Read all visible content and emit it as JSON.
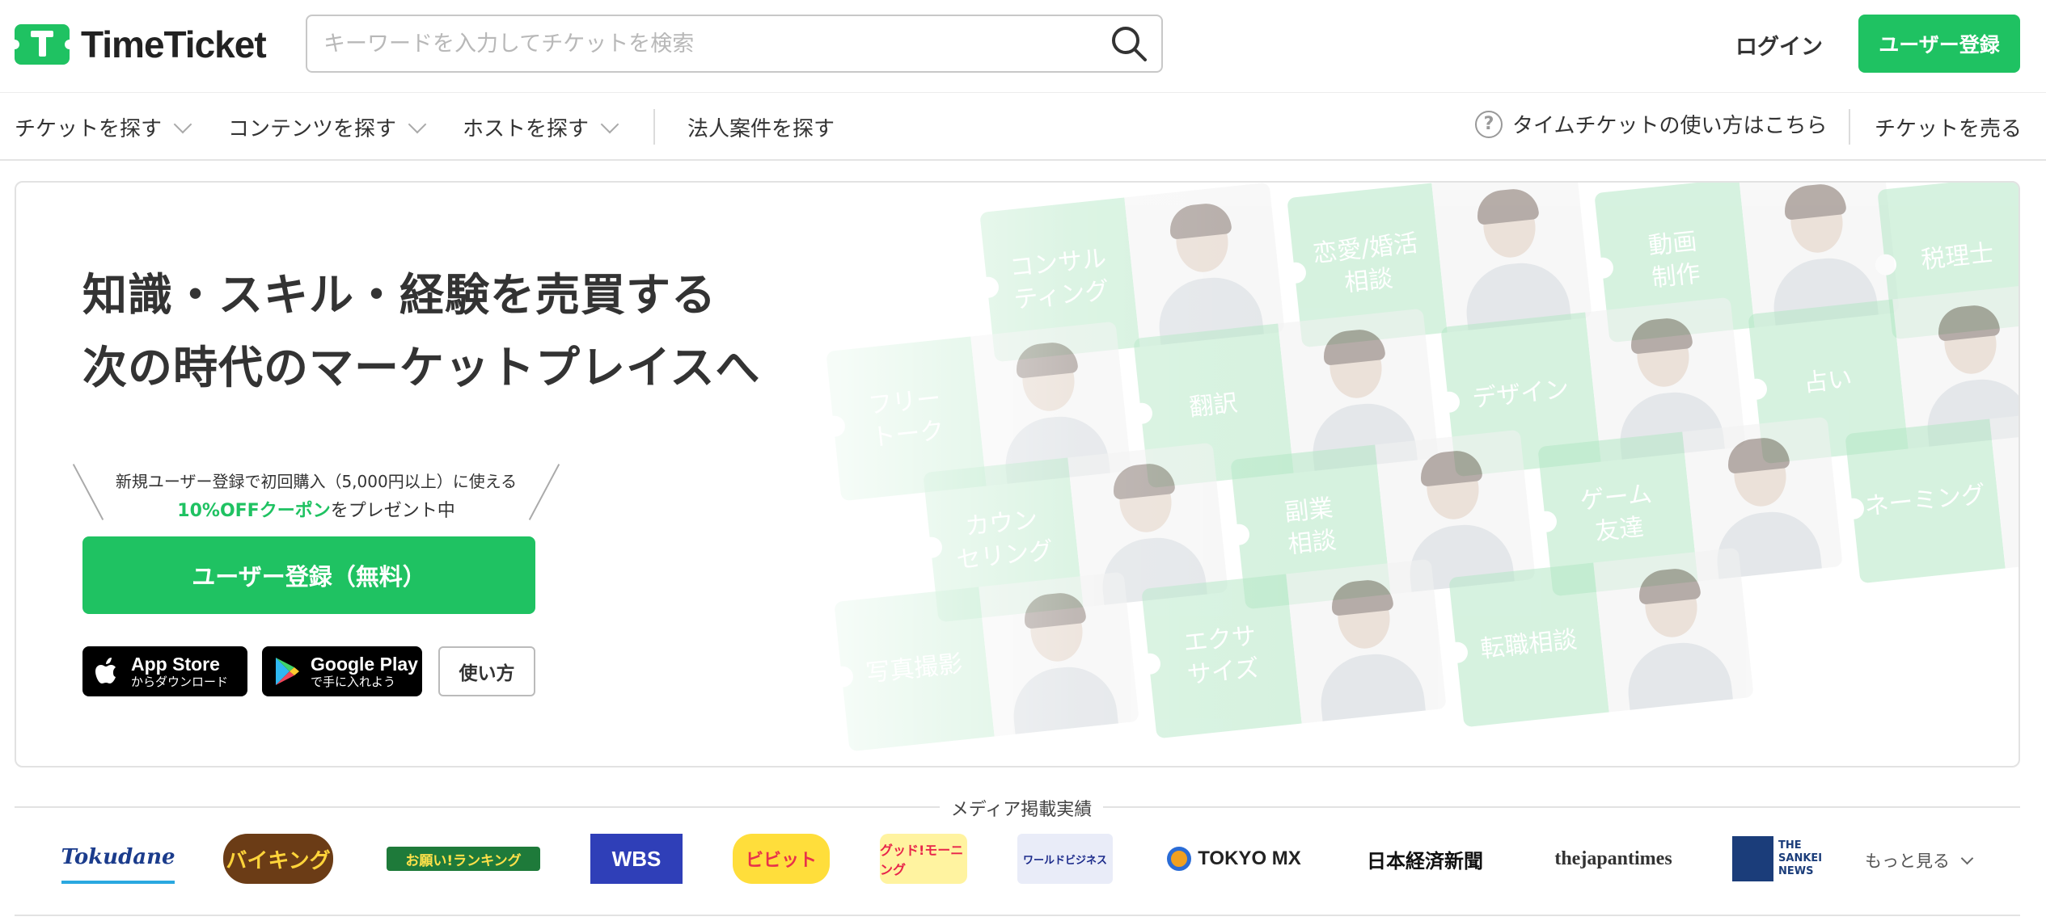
{
  "header": {
    "logo_text": "TimeTicket",
    "search_placeholder": "キーワードを入力してチケットを検索",
    "login_label": "ログイン",
    "register_label": "ユーザー登録"
  },
  "nav": {
    "items": [
      {
        "label": "チケットを探す"
      },
      {
        "label": "コンテンツを探す"
      },
      {
        "label": "ホストを探す"
      },
      {
        "label": "法人案件を探す"
      }
    ],
    "help_label": "タイムチケットの使い方はこちら",
    "sell_label": "チケットを売る"
  },
  "hero": {
    "title_line1": "知識・スキル・経験を売買する",
    "title_line2": "次の時代のマーケットプレイスへ",
    "coupon_line1": "新規ユーザー登録で初回購入（5,000円以上）に使える",
    "coupon_highlight": "10%OFFクーポン",
    "coupon_rest": "をプレゼント中",
    "cta_label": "ユーザー登録（無料）",
    "appstore_big": "App Store",
    "appstore_small": "からダウンロード",
    "googleplay_big": "Google Play",
    "googleplay_small": "で手に入れよう",
    "howto_label": "使い方",
    "accent_color": "#1fc262"
  },
  "collage": {
    "cards": [
      {
        "label": "コンサル\nティング"
      },
      {
        "label": "恋愛/婚活\n相談"
      },
      {
        "label": "動画\n制作"
      },
      {
        "label": "税理士"
      },
      {
        "label": "フリー\nトーク"
      },
      {
        "label": "翻訳"
      },
      {
        "label": "デザイン"
      },
      {
        "label": "占い"
      },
      {
        "label": "カウン\nセリング"
      },
      {
        "label": "副業\n相談"
      },
      {
        "label": "ゲーム\n友達"
      },
      {
        "label": "ネーミング"
      },
      {
        "label": "写真撮影"
      },
      {
        "label": "エクサ\nサイズ"
      },
      {
        "label": "転職相談"
      }
    ]
  },
  "media": {
    "title": "メディア掲載実績",
    "logos": [
      {
        "name": "Tokudane"
      },
      {
        "name": "バイキング"
      },
      {
        "name": "お願い!ランキング"
      },
      {
        "name": "WBS"
      },
      {
        "name": "ビビット"
      },
      {
        "name": "グッド!モーニング"
      },
      {
        "name": "ワールドビジネス"
      },
      {
        "name": "TOKYO MX"
      },
      {
        "name": "日本経済新聞"
      },
      {
        "name": "thejapantimes"
      },
      {
        "name": "THE SANKEI NEWS"
      }
    ],
    "more_label": "もっと見る"
  }
}
